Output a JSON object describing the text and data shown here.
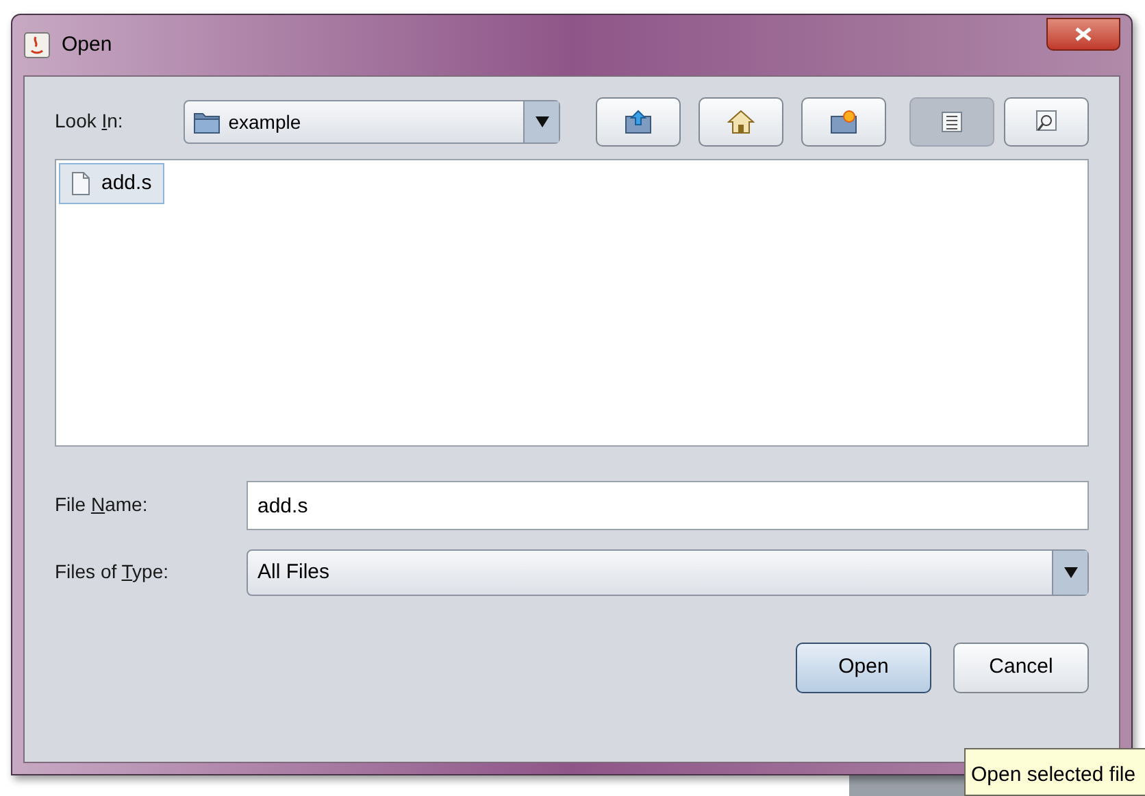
{
  "window": {
    "title": "Open"
  },
  "look_in": {
    "label": [
      {
        "text": "Look "
      },
      {
        "text": "I",
        "mnemonic": true
      },
      {
        "text": "n:"
      }
    ],
    "value": "example"
  },
  "toolbar": [
    {
      "kind": "up",
      "selected": false
    },
    {
      "kind": "home",
      "selected": false
    },
    {
      "kind": "new-folder",
      "selected": false
    },
    {
      "kind": "list",
      "selected": true
    },
    {
      "kind": "details",
      "selected": false
    }
  ],
  "files": [
    {
      "name": "add.s",
      "selected": true
    }
  ],
  "file_name": {
    "label": [
      {
        "text": "File "
      },
      {
        "text": "N",
        "mnemonic": true
      },
      {
        "text": "ame:"
      }
    ],
    "value": "add.s"
  },
  "file_type": {
    "label": [
      {
        "text": "Files of "
      },
      {
        "text": "T",
        "mnemonic": true
      },
      {
        "text": "ype:"
      }
    ],
    "value": "All Files"
  },
  "buttons": [
    {
      "label": "Open",
      "default": true
    },
    {
      "label": "Cancel",
      "default": false
    }
  ],
  "tooltip": "Open selected file"
}
